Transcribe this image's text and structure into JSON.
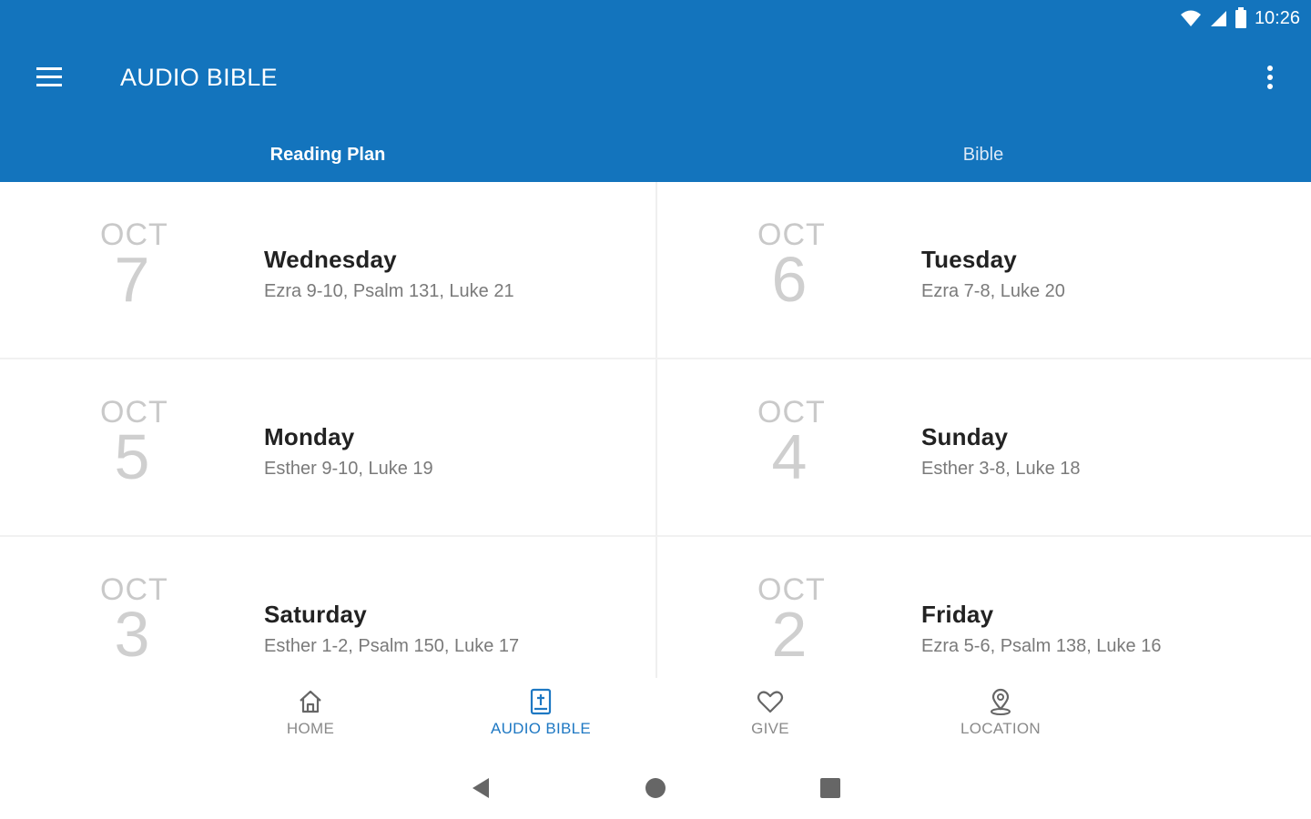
{
  "status_bar": {
    "time": "10:26"
  },
  "toolbar": {
    "title": "AUDIO BIBLE"
  },
  "tabs": [
    {
      "label": "Reading Plan",
      "active": true
    },
    {
      "label": "Bible",
      "active": false
    }
  ],
  "readings": [
    {
      "month": "OCT",
      "day": "7",
      "weekday": "Wednesday",
      "passages": "Ezra 9-10, Psalm 131, Luke 21"
    },
    {
      "month": "OCT",
      "day": "6",
      "weekday": "Tuesday",
      "passages": "Ezra 7-8, Luke 20"
    },
    {
      "month": "OCT",
      "day": "5",
      "weekday": "Monday",
      "passages": "Esther 9-10, Luke 19"
    },
    {
      "month": "OCT",
      "day": "4",
      "weekday": "Sunday",
      "passages": "Esther 3-8, Luke 18"
    },
    {
      "month": "OCT",
      "day": "3",
      "weekday": "Saturday",
      "passages": "Esther 1-2, Psalm 150, Luke 17"
    },
    {
      "month": "OCT",
      "day": "2",
      "weekday": "Friday",
      "passages": "Ezra 5-6, Psalm 138, Luke 16"
    }
  ],
  "bottom_nav": [
    {
      "label": "HOME",
      "icon": "home-icon",
      "active": false
    },
    {
      "label": "AUDIO BIBLE",
      "icon": "bible-icon",
      "active": true
    },
    {
      "label": "GIVE",
      "icon": "heart-icon",
      "active": false
    },
    {
      "label": "LOCATION",
      "icon": "location-pin-icon",
      "active": false
    }
  ],
  "colors": {
    "primary": "#1374bd",
    "accent": "#1e78c3",
    "inactive": "#8a8a8a"
  }
}
